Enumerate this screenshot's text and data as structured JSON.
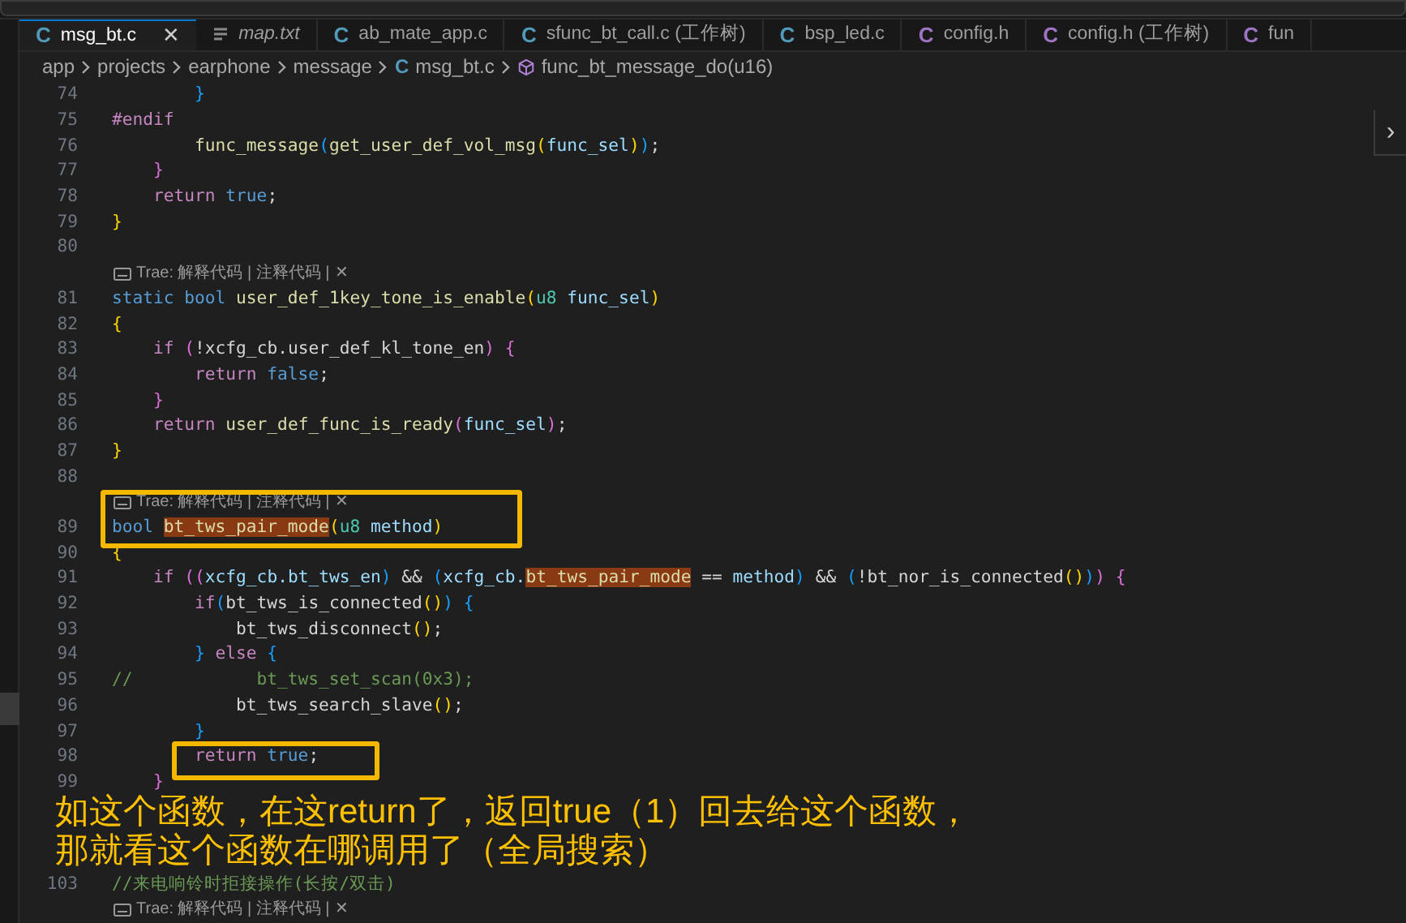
{
  "tabs": [
    {
      "label": "msg_bt.c",
      "icon": "C",
      "kind": "c",
      "selected": true,
      "preview": false,
      "close": "✕"
    },
    {
      "label": "map.txt",
      "kind": "txt",
      "selected": false,
      "preview": true
    },
    {
      "label": "ab_mate_app.c",
      "icon": "C",
      "kind": "c",
      "selected": false,
      "preview": false
    },
    {
      "label": "sfunc_bt_call.c (工作树)",
      "icon": "C",
      "kind": "c",
      "selected": false,
      "preview": false
    },
    {
      "label": "bsp_led.c",
      "icon": "C",
      "kind": "c",
      "selected": false,
      "preview": false
    },
    {
      "label": "config.h",
      "icon": "C",
      "kind": "h",
      "selected": false,
      "preview": false
    },
    {
      "label": "config.h (工作树)",
      "icon": "C",
      "kind": "h",
      "selected": false,
      "preview": false
    },
    {
      "label": "fun",
      "icon": "C",
      "kind": "h",
      "selected": false,
      "preview": false
    }
  ],
  "breadcrumb": [
    {
      "label": "app",
      "kind": "folder"
    },
    {
      "label": "projects",
      "kind": "folder"
    },
    {
      "label": "earphone",
      "kind": "folder"
    },
    {
      "label": "message",
      "kind": "folder"
    },
    {
      "label": "msg_bt.c",
      "kind": "file",
      "icon": "C"
    },
    {
      "label": "func_bt_message_do(u16)",
      "kind": "symbol"
    }
  ],
  "panel_toggle": "›",
  "lines": [
    {
      "kind": "code",
      "number": "74",
      "tokens": [
        {
          "text": "        }",
          "kind": "b3"
        }
      ]
    },
    {
      "kind": "code",
      "number": "75",
      "tokens": [
        {
          "text": "#endif",
          "kind": "c"
        }
      ]
    },
    {
      "kind": "code",
      "number": "76",
      "tokens": [
        {
          "text": "        func_message",
          "kind": "f"
        },
        {
          "text": "(",
          "kind": "b3"
        },
        {
          "text": "get_user_def_vol_msg",
          "kind": "f"
        },
        {
          "text": "(",
          "kind": "b1"
        },
        {
          "text": "func_sel",
          "kind": "v"
        },
        {
          "text": ")",
          "kind": "b1"
        },
        {
          "text": ")",
          "kind": "b3"
        },
        {
          "text": ";",
          "kind": "p"
        }
      ]
    },
    {
      "kind": "code",
      "number": "77",
      "tokens": [
        {
          "text": "    }",
          "kind": "b2"
        }
      ]
    },
    {
      "kind": "code",
      "number": "78",
      "tokens": [
        {
          "text": "    return ",
          "kind": "c"
        },
        {
          "text": "true",
          "kind": "k"
        },
        {
          "text": ";",
          "kind": "p"
        }
      ]
    },
    {
      "kind": "code",
      "number": "79",
      "tokens": [
        {
          "text": "}",
          "kind": "b1"
        }
      ]
    },
    {
      "kind": "code",
      "number": "80"
    },
    {
      "kind": "lens",
      "label": "Trae: 解释代码 | 注释代码 |",
      "close": "✕"
    },
    {
      "kind": "code",
      "number": "81",
      "tokens": [
        {
          "text": "static bool ",
          "kind": "k"
        },
        {
          "text": "user_def_1key_tone_is_enable",
          "kind": "f"
        },
        {
          "text": "(",
          "kind": "b1"
        },
        {
          "text": "u8 ",
          "kind": "t"
        },
        {
          "text": "func_sel",
          "kind": "v"
        },
        {
          "text": ")",
          "kind": "b1"
        }
      ]
    },
    {
      "kind": "code",
      "number": "82",
      "tokens": [
        {
          "text": "{",
          "kind": "b1"
        }
      ]
    },
    {
      "kind": "code",
      "number": "83",
      "tokens": [
        {
          "text": "    if ",
          "kind": "c"
        },
        {
          "text": "(",
          "kind": "b2"
        },
        {
          "text": "!xcfg_cb.user_def_kl_tone_en",
          "kind": "p"
        },
        {
          "text": ") {",
          "kind": "b2"
        }
      ]
    },
    {
      "kind": "code",
      "number": "84",
      "tokens": [
        {
          "text": "        return ",
          "kind": "c"
        },
        {
          "text": "false",
          "kind": "k"
        },
        {
          "text": ";",
          "kind": "p"
        }
      ]
    },
    {
      "kind": "code",
      "number": "85",
      "tokens": [
        {
          "text": "    }",
          "kind": "b2"
        }
      ]
    },
    {
      "kind": "code",
      "number": "86",
      "tokens": [
        {
          "text": "    return ",
          "kind": "c"
        },
        {
          "text": "user_def_func_is_ready",
          "kind": "f"
        },
        {
          "text": "(",
          "kind": "b2"
        },
        {
          "text": "func_sel",
          "kind": "v"
        },
        {
          "text": ")",
          "kind": "b2"
        },
        {
          "text": ";",
          "kind": "p"
        }
      ]
    },
    {
      "kind": "code",
      "number": "87",
      "tokens": [
        {
          "text": "}",
          "kind": "b1"
        }
      ]
    },
    {
      "kind": "code",
      "number": "88"
    },
    {
      "kind": "lens",
      "label": "Trae: 解释代码 | 注释代码 |",
      "close": "✕"
    },
    {
      "kind": "code",
      "number": "89",
      "tokens": [
        {
          "text": "bool ",
          "kind": "k"
        },
        {
          "text": "bt_tws_pair_mode",
          "kind": "h"
        },
        {
          "text": "(",
          "kind": "b1"
        },
        {
          "text": "u8 ",
          "kind": "t"
        },
        {
          "text": "method",
          "kind": "v"
        },
        {
          "text": ")",
          "kind": "b1"
        }
      ]
    },
    {
      "kind": "code",
      "number": "90",
      "tokens": [
        {
          "text": "{",
          "kind": "b1"
        }
      ]
    },
    {
      "kind": "code",
      "number": "91",
      "tokens": [
        {
          "text": "    if ",
          "kind": "c"
        },
        {
          "text": "((",
          "kind": "b2"
        },
        {
          "text": "xcfg_cb.bt_tws_en",
          "kind": "v"
        },
        {
          "text": ")",
          "kind": "b3"
        },
        {
          "text": " && ",
          "kind": "p"
        },
        {
          "text": "(",
          "kind": "b3"
        },
        {
          "text": "xcfg_cb.",
          "kind": "v"
        },
        {
          "text": "bt_tws_pair_mode",
          "kind": "h"
        },
        {
          "text": " == ",
          "kind": "p"
        },
        {
          "text": "method",
          "kind": "v"
        },
        {
          "text": ")",
          "kind": "b3"
        },
        {
          "text": " && ",
          "kind": "p"
        },
        {
          "text": "(",
          "kind": "b3"
        },
        {
          "text": "!bt_nor_is_connected",
          "kind": "p"
        },
        {
          "text": "()",
          "kind": "b1"
        },
        {
          "text": ")",
          "kind": "b3"
        },
        {
          "text": ") {",
          "kind": "b2"
        }
      ]
    },
    {
      "kind": "code",
      "number": "92",
      "tokens": [
        {
          "text": "        if",
          "kind": "c"
        },
        {
          "text": "(",
          "kind": "b3"
        },
        {
          "text": "bt_tws_is_connected",
          "kind": "p"
        },
        {
          "text": "()",
          "kind": "b1"
        },
        {
          "text": ") {",
          "kind": "b3"
        }
      ]
    },
    {
      "kind": "code",
      "number": "93",
      "tokens": [
        {
          "text": "            bt_tws_disconnect",
          "kind": "p"
        },
        {
          "text": "()",
          "kind": "b1"
        },
        {
          "text": ";",
          "kind": "p"
        }
      ]
    },
    {
      "kind": "code",
      "number": "94",
      "tokens": [
        {
          "text": "        } ",
          "kind": "b3"
        },
        {
          "text": "else ",
          "kind": "c"
        },
        {
          "text": "{",
          "kind": "b3"
        }
      ]
    },
    {
      "kind": "code",
      "number": "95",
      "tokens": [
        {
          "text": "//            bt_tws_set_scan(0x3);",
          "kind": "m"
        }
      ]
    },
    {
      "kind": "code",
      "number": "96",
      "tokens": [
        {
          "text": "            bt_tws_search_slave",
          "kind": "p"
        },
        {
          "text": "()",
          "kind": "b1"
        },
        {
          "text": ";",
          "kind": "p"
        }
      ]
    },
    {
      "kind": "code",
      "number": "97",
      "tokens": [
        {
          "text": "        }",
          "kind": "b3"
        }
      ]
    },
    {
      "kind": "code",
      "number": "98",
      "tokens": [
        {
          "text": "        return ",
          "kind": "c"
        },
        {
          "text": "true",
          "kind": "k"
        },
        {
          "text": ";",
          "kind": "p"
        }
      ]
    },
    {
      "kind": "code",
      "number": "99",
      "tokens": [
        {
          "text": "    }",
          "kind": "b2"
        }
      ]
    },
    {
      "kind": "code"
    },
    {
      "kind": "code"
    },
    {
      "kind": "code"
    },
    {
      "kind": "code",
      "number": "103",
      "tokens": [
        {
          "text": "//来电响铃时拒接操作(长按/双击)",
          "kind": "m"
        }
      ]
    },
    {
      "kind": "lens",
      "label": "Trae: 解释代码 | 注释代码 |",
      "close": "✕"
    }
  ],
  "annotation": {
    "lines": [
      "如这个函数，在这return了，返回true（1）回去给这个函数，",
      "那就看这个函数在哪调用了（全局搜索）"
    ]
  }
}
